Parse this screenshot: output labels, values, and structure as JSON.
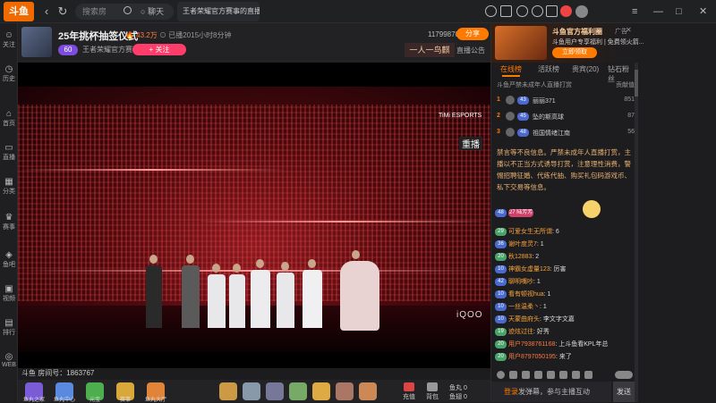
{
  "topbar": {
    "logo": "斗鱼",
    "search_placeholder": "搜索房",
    "chat_label": "聊天",
    "tab_title": "王者荣耀官方赛事的直播间 ⊗",
    "window_controls": [
      "—",
      "□",
      "✕"
    ]
  },
  "sidebar": {
    "items": [
      {
        "icon": "user-icon",
        "label": "关注"
      },
      {
        "icon": "clock-icon",
        "label": "历史"
      },
      {
        "icon": "home-icon",
        "label": "首页"
      },
      {
        "icon": "tv-icon",
        "label": "直播"
      },
      {
        "icon": "grid-icon",
        "label": "分类"
      },
      {
        "icon": "trophy-icon",
        "label": "赛事"
      },
      {
        "icon": "fish-icon",
        "label": "鱼吧"
      },
      {
        "icon": "video-icon",
        "label": "视频"
      },
      {
        "icon": "rank-icon",
        "label": "排行"
      },
      {
        "icon": "web-icon",
        "label": "WEB"
      }
    ]
  },
  "header": {
    "title": "25年挑杯抽签仪式",
    "heat": "🔥 43.2万",
    "status": "⊙ 已播2015小时8分钟",
    "level": "60",
    "anchor": "王者荣耀官方赛事",
    "follow": "+ 关注",
    "fans": "11799870",
    "share": "分享",
    "banner": "一人一鸟麒",
    "notice": "直播公告"
  },
  "video": {
    "watermark_brand": "TiMi ESPORTS",
    "watermark_live": "重播",
    "sponsor": "iQOO"
  },
  "room": {
    "label": "斗鱼  房间号：1863767"
  },
  "bottom": {
    "gifts": [
      "鱼丸之家",
      "鱼丸中心",
      "元宝",
      "赛事",
      "鱼丸大厅"
    ],
    "buttons": [
      "充值",
      "背包",
      "鱼丸 0",
      "鱼翅 0"
    ]
  },
  "ad": {
    "title": "斗鱼官方福利圈",
    "subtitle": "斗鱼用户专享福利 | 免费领火箭...",
    "button": "立即领取",
    "tag": "广告"
  },
  "right": {
    "tabs": [
      "在线榜",
      "活跃榜",
      "贵宾(20)",
      "钻石粉丝"
    ],
    "note": "斗鱼严禁未成年人直播打赏",
    "contrib": "贡献值",
    "ranks": [
      {
        "n": "1",
        "lv": "43",
        "name": "丽丽371",
        "val": "851"
      },
      {
        "n": "2",
        "lv": "45",
        "name": "坠的斯高球",
        "val": "87"
      },
      {
        "n": "3",
        "lv": "48",
        "name": "祖国情绪江南",
        "val": "56"
      }
    ],
    "system": "禁言等不良信息。严禁未成年人直播打赏，主播以不正当方式诱导打赏，注意理性消费，警惕招聘征婚、代练代抽、购买礼包码游戏币、私下交易等信息。",
    "messages": [
      {
        "lv": "48",
        "badge": "27 陆芳芳",
        "user": "",
        "text": ""
      },
      {
        "lv": "29",
        "badge": "",
        "user": "可爱女生无所谓",
        "text": ": 6"
      },
      {
        "lv": "36",
        "badge": "",
        "user": "谢叶度灵7",
        "text": ": 1"
      },
      {
        "lv": "20",
        "badge": "",
        "user": "秋12883",
        "text": ": 2"
      },
      {
        "lv": "10",
        "badge": "",
        "user": "神霸女虚量123",
        "text": ": 厉害"
      },
      {
        "lv": "42",
        "badge": "",
        "user": "聊明嘴吵",
        "text": ": 1"
      },
      {
        "lv": "10",
        "badge": "",
        "user": "看有顿视hua",
        "text": ": 1"
      },
      {
        "lv": "10",
        "badge": "",
        "user": "一丝温柔丶",
        "text": ": 1"
      },
      {
        "lv": "10",
        "badge": "",
        "user": "天蒙曲府头",
        "text": ": 李文字文嘉"
      },
      {
        "lv": "19",
        "badge": "",
        "user": "迹炫过往",
        "text": ": 好秀"
      },
      {
        "lv": "20",
        "badge": "",
        "user": "用户7938761168",
        "text": ": 上斗鱼看KPL年总"
      },
      {
        "lv": "20",
        "badge": "",
        "user": "用户8797050195",
        "text": ": 来了"
      }
    ],
    "input": "登录发弹幕，参与主播互动",
    "input_highlight": "登录",
    "send": "发送"
  }
}
